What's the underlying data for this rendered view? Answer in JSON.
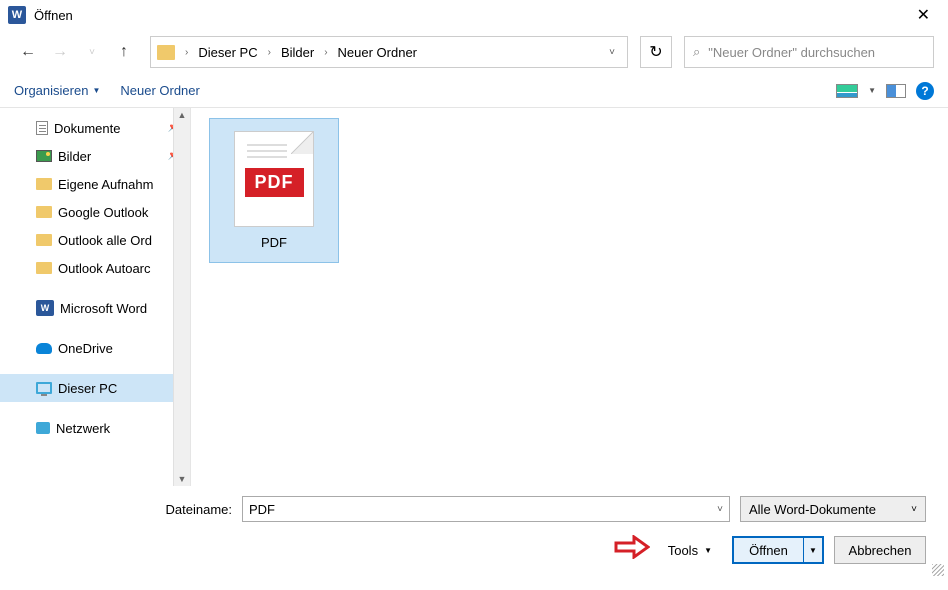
{
  "titlebar": {
    "title": "Öffnen"
  },
  "breadcrumbs": {
    "a": "Dieser PC",
    "b": "Bilder",
    "c": "Neuer Ordner"
  },
  "search": {
    "placeholder": "\"Neuer Ordner\" durchsuchen"
  },
  "toolbar": {
    "organize": "Organisieren",
    "newfolder": "Neuer Ordner"
  },
  "sidebar": {
    "items": [
      {
        "label": "Dokumente",
        "pin": true
      },
      {
        "label": "Bilder",
        "pin": true
      },
      {
        "label": "Eigene Aufnahm"
      },
      {
        "label": "Google Outlook"
      },
      {
        "label": "Outlook alle Ord"
      },
      {
        "label": "Outlook Autoarc"
      }
    ],
    "word": "Microsoft Word",
    "onedrive": "OneDrive",
    "thispc": "Dieser PC",
    "network": "Netzwerk"
  },
  "file": {
    "name": "PDF",
    "badge": "PDF"
  },
  "footer": {
    "filename_label": "Dateiname:",
    "filename_value": "PDF",
    "filter": "Alle Word-Dokumente",
    "tools": "Tools",
    "open": "Öffnen",
    "cancel": "Abbrechen"
  }
}
